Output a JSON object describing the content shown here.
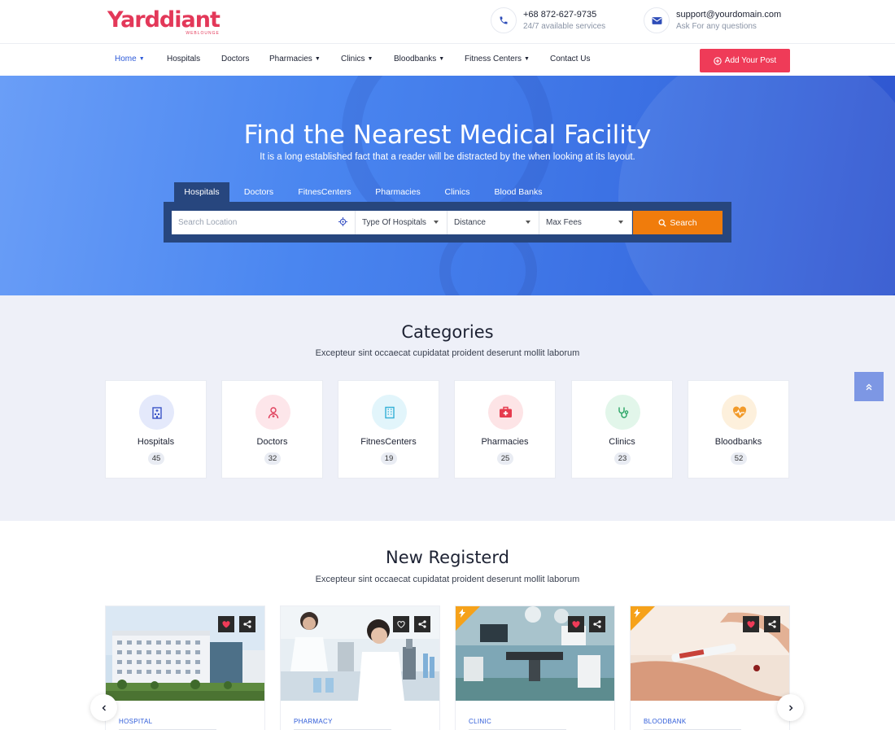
{
  "brand": {
    "name": "Yarddiant",
    "tagline": "WEBLOUNGE",
    "color": "#e33859"
  },
  "contacts": [
    {
      "icon": "phone-icon",
      "title": "+68 872-627-9735",
      "sub": "24/7 available services"
    },
    {
      "icon": "envelope-icon",
      "title": "support@yourdomain.com",
      "sub": "Ask For any questions"
    }
  ],
  "nav": {
    "items": [
      {
        "label": "Home",
        "dropdown": true,
        "active": true
      },
      {
        "label": "Hospitals",
        "dropdown": false
      },
      {
        "label": "Doctors",
        "dropdown": false
      },
      {
        "label": "Pharmacies",
        "dropdown": true
      },
      {
        "label": "Clinics",
        "dropdown": true
      },
      {
        "label": "Bloodbanks",
        "dropdown": true
      },
      {
        "label": "Fitness Centers",
        "dropdown": true
      },
      {
        "label": "Contact Us",
        "dropdown": false
      }
    ],
    "cta": "Add Your Post"
  },
  "hero": {
    "title": "Find the Nearest Medical Facility",
    "subtitle": "It is a long established fact that a reader will be distracted by the when looking at its layout.",
    "tabs": [
      "Hospitals",
      "Doctors",
      "FitnesCenters",
      "Pharmacies",
      "Clinics",
      "Blood Banks"
    ],
    "active_tab": "Hospitals",
    "search": {
      "location_placeholder": "Search Location",
      "type_select": "Type Of Hospitals",
      "distance_select": "Distance",
      "fees_select": "Max Fees",
      "button": "Search"
    }
  },
  "categories": {
    "title": "Categories",
    "subtitle": "Excepteur sint occaecat cupidatat proident deserunt mollit laborum",
    "items": [
      {
        "name": "Hospitals",
        "count": "45",
        "icon": "hospital-building-icon",
        "color": "#3a54c6",
        "bg": "#e4e9fb"
      },
      {
        "name": "Doctors",
        "count": "32",
        "icon": "doctor-icon",
        "color": "#e0405c",
        "bg": "#fde6ea"
      },
      {
        "name": "FitnesCenters",
        "count": "19",
        "icon": "building-icon",
        "color": "#33b0d6",
        "bg": "#e2f5fb"
      },
      {
        "name": "Pharmacies",
        "count": "25",
        "icon": "first-aid-kit-icon",
        "color": "#e63b4e",
        "bg": "#fde4e6"
      },
      {
        "name": "Clinics",
        "count": "23",
        "icon": "stethoscope-icon",
        "color": "#2aa565",
        "bg": "#e2f6ea"
      },
      {
        "name": "Bloodbanks",
        "count": "52",
        "icon": "heartbeat-icon",
        "color": "#f29b2b",
        "bg": "#fdf0dc"
      }
    ]
  },
  "new_registered": {
    "title": "New Registerd",
    "subtitle": "Excepteur sint occaecat cupidatat proident deserunt mollit laborum",
    "listings": [
      {
        "category": "HOSPITAL",
        "favorited": true,
        "featured": false
      },
      {
        "category": "PHARMACY",
        "favorited": false,
        "featured": false
      },
      {
        "category": "CLINIC",
        "favorited": true,
        "featured": true
      },
      {
        "category": "BLOODBANK",
        "favorited": true,
        "featured": true
      }
    ]
  }
}
